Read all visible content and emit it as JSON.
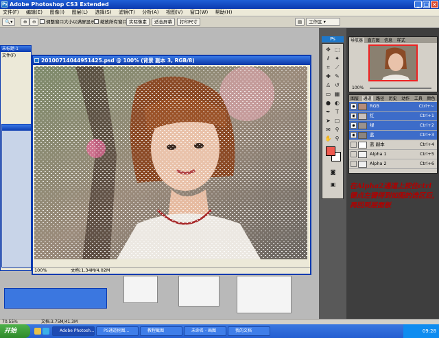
{
  "app": {
    "title": "Adobe Photoshop CS3 Extended",
    "ps_badge": "Ps"
  },
  "window_controls": {
    "minimize": "_",
    "maximize": "□",
    "close": "×"
  },
  "menu": [
    "文件(F)",
    "编辑(E)",
    "图像(I)",
    "图层(L)",
    "选择(S)",
    "滤镜(T)",
    "分析(A)",
    "视图(V)",
    "窗口(W)",
    "帮助(H)"
  ],
  "options_bar": {
    "check_resize": "调整窗口大小以满屏显示",
    "check_zoom_all": "缩放所有窗口",
    "btn_actual": "实际像素",
    "btn_fit": "适合屏幕",
    "btn_print": "打印尺寸",
    "workspace": "工作区 ▾"
  },
  "document": {
    "title": "20100714044951425.psd @ 100% (背景 副本 3, RGB/8)",
    "zoom": "100%",
    "doc_size": "文档:1.34M/4.02M"
  },
  "bg_window": {
    "title": "未标题-1",
    "menu_label": "文件(F)"
  },
  "navigator": {
    "tabs": [
      "导航器",
      "直方图",
      "信息",
      "样式"
    ],
    "zoom": "100%"
  },
  "channels": {
    "tabs": [
      "图层",
      "通道",
      "路径",
      "历史",
      "动作",
      "工具",
      "颜色"
    ],
    "rows": [
      {
        "name": "RGB",
        "key": "Ctrl+~",
        "selected": true,
        "thumb": "#b58c7a"
      },
      {
        "name": "红",
        "key": "Ctrl+1",
        "selected": true,
        "thumb": "#c8c0bc"
      },
      {
        "name": "绿",
        "key": "Ctrl+2",
        "selected": true,
        "thumb": "#9a928e"
      },
      {
        "name": "蓝",
        "key": "Ctrl+3",
        "selected": true,
        "thumb": "#8a8480"
      },
      {
        "name": "蓝 副本",
        "key": "Ctrl+4",
        "selected": false,
        "thumb": "#ffffff"
      },
      {
        "name": "Alpha 1",
        "key": "Ctrl+5",
        "selected": false,
        "thumb": "#f2f2f2"
      },
      {
        "name": "Alpha 2",
        "key": "Ctrl+6",
        "selected": false,
        "thumb": "#efefef"
      }
    ]
  },
  "annotation": "在Alpha2通道上按住ctrl键点左键得到如图的选区后,再回到层面板",
  "status": {
    "zoom": "70.55%",
    "doc_size": "文档:3.75M/41.3M"
  },
  "taskbar": {
    "start": "开始",
    "tasks": [
      "Adobe Photosh...",
      "PS通道抠图...",
      "教程截图",
      "未命名 - 画图",
      "我的文档"
    ],
    "clock": "09:28"
  },
  "colors": {
    "foreground": "#f05a4f",
    "background": "#ffffff",
    "xp_blue": "#0b3ab0"
  }
}
